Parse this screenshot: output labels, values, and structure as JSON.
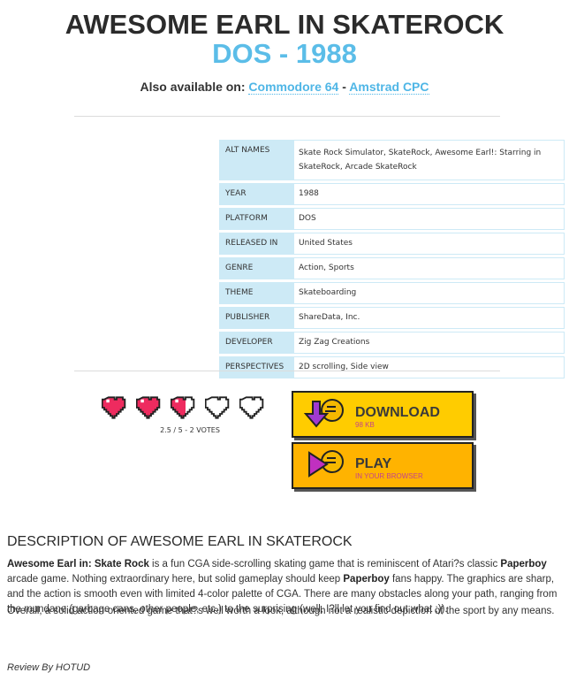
{
  "header": {
    "title": "AWESOME EARL IN SKATEROCK",
    "subtitle": "DOS - 1988",
    "also_prefix": "Also available on:",
    "also_links": [
      "Commodore 64",
      "Amstrad CPC"
    ],
    "also_sep": " - "
  },
  "info": {
    "rows": [
      {
        "key": "ALT NAMES",
        "value": "Skate Rock Simulator, SkateRock, Awesome Earl!: Starring in SkateRock, Arcade SkateRock"
      },
      {
        "key": "YEAR",
        "value": "1988"
      },
      {
        "key": "PLATFORM",
        "value": "DOS"
      },
      {
        "key": "RELEASED IN",
        "value": "United States"
      },
      {
        "key": "GENRE",
        "value": "Action, Sports"
      },
      {
        "key": "THEME",
        "value": "Skateboarding"
      },
      {
        "key": "PUBLISHER",
        "value": "ShareData, Inc."
      },
      {
        "key": "DEVELOPER",
        "value": "Zig Zag Creations"
      },
      {
        "key": "PERSPECTIVES",
        "value": "2D scrolling, Side view"
      }
    ]
  },
  "rating": {
    "score": 2.5,
    "max": 5,
    "votes_text": "2.5 / 5 - 2 VOTES",
    "filled_color": "#ee2b5f",
    "empty_color": "#ffffff"
  },
  "buttons": {
    "download": {
      "label": "DOWNLOAD",
      "sub": "98 KB",
      "color": "#ffcc00"
    },
    "play": {
      "label": "PLAY",
      "sub": "IN YOUR BROWSER",
      "color": "#ffb300"
    }
  },
  "description": {
    "title": "DESCRIPTION OF AWESOME EARL IN SKATEROCK",
    "p1_parts": [
      {
        "b": "Awesome Earl in: Skate Rock"
      },
      {
        "t": " is a fun CGA side-scrolling skating game that is reminiscent of Atari?s classic "
      },
      {
        "b": "Paperboy"
      },
      {
        "t": " arcade game. Nothing extraordinary here, but solid gameplay should keep "
      },
      {
        "b": "Paperboy"
      },
      {
        "t": " fans happy. The graphics are sharp, and the action is smooth even with limited 4-color palette of CGA. There are many obstacles along your path, ranging from the mundane (garbage cans, other people, etc.) to the surprising (well, I?ll let you find out what ;))."
      }
    ],
    "p2": "Overall, a solid action-oriented game that?s well worth a look, although not a realistic depiction of the sport by any means.",
    "review_by": "Review By HOTUD"
  },
  "icons": {
    "download": "download-arrow-icon",
    "play": "play-triangle-icon",
    "heart": "pixel-heart-icon"
  }
}
